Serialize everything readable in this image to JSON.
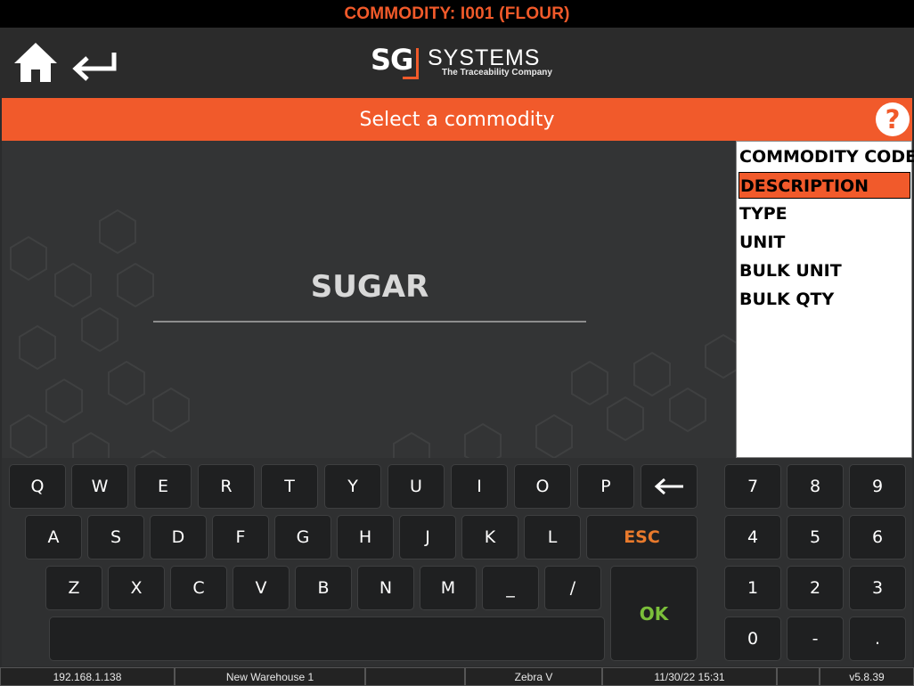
{
  "top_title": "COMMODITY: I001 (FLOUR)",
  "header": {
    "home_icon": "home-icon",
    "back_icon": "back-arrow-icon",
    "logo": {
      "sg": "SG",
      "brand": "SYSTEMS",
      "tagline": "The Traceability Company"
    }
  },
  "prompt": {
    "text": "Select a commodity",
    "help_label": "?"
  },
  "input": {
    "value": "SUGAR"
  },
  "fields": [
    {
      "label": "COMMODITY CODE",
      "selected": false
    },
    {
      "label": "DESCRIPTION",
      "selected": true
    },
    {
      "label": "TYPE",
      "selected": false
    },
    {
      "label": "UNIT",
      "selected": false
    },
    {
      "label": "BULK UNIT",
      "selected": false
    },
    {
      "label": "BULK QTY",
      "selected": false
    }
  ],
  "keyboard": {
    "row1": [
      "Q",
      "W",
      "E",
      "R",
      "T",
      "Y",
      "U",
      "I",
      "O",
      "P"
    ],
    "backspace_icon": "backspace-arrow-icon",
    "row2": [
      "A",
      "S",
      "D",
      "F",
      "G",
      "H",
      "J",
      "K",
      "L"
    ],
    "esc": "ESC",
    "row3": [
      "Z",
      "X",
      "C",
      "V",
      "B",
      "N",
      "M",
      "_",
      "/"
    ],
    "ok": "OK",
    "numpad": [
      "7",
      "8",
      "9",
      "4",
      "5",
      "6",
      "1",
      "2",
      "3",
      "0",
      "-",
      "."
    ]
  },
  "status": [
    "192.168.1.138",
    "New Warehouse 1",
    "",
    "Zebra V",
    "11/30/22 15:31",
    "",
    "v5.8.39"
  ],
  "colors": {
    "accent": "#f15a2b",
    "ok": "#7bbf3a",
    "esc": "#e97a2c"
  }
}
